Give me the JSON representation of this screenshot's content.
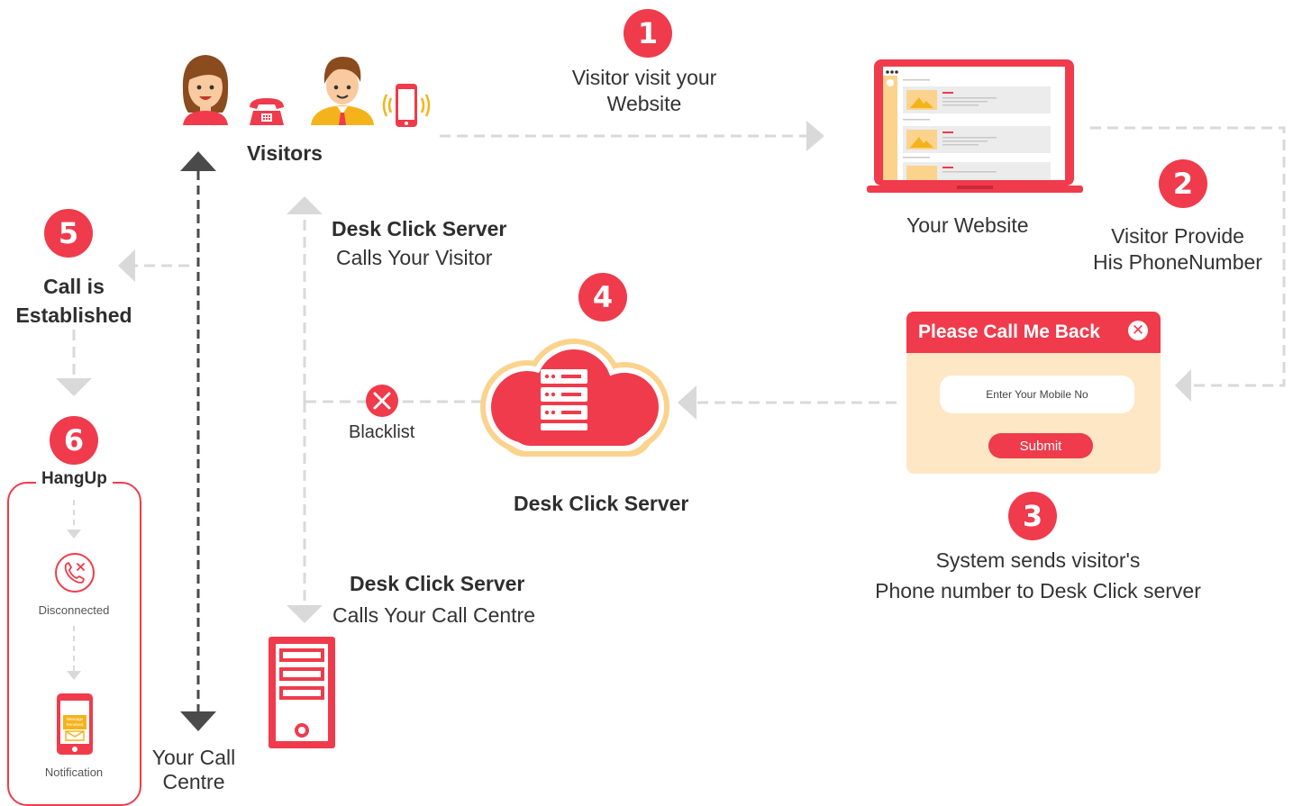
{
  "steps": {
    "s1": {
      "number": "1",
      "line1": "Visitor visit your",
      "line2": "Website"
    },
    "s2": {
      "number": "2",
      "line1": "Visitor Provide",
      "line2": "His PhoneNumber"
    },
    "s3": {
      "number": "3",
      "line1": "System sends visitor's",
      "line2": "Phone number to Desk Click server"
    },
    "s4": {
      "number": "4"
    },
    "s5": {
      "number": "5",
      "line1": "Call is",
      "line2": "Established"
    },
    "s6": {
      "number": "6"
    }
  },
  "labels": {
    "visitors": "Visitors",
    "your_website": "Your Website",
    "desk_click_server": "Desk Click Server",
    "calls_visitor_title": "Desk Click Server",
    "calls_visitor_sub": "Calls Your Visitor",
    "calls_centre_title": "Desk Click Server",
    "calls_centre_sub": "Calls Your Call Centre",
    "blacklist": "Blacklist",
    "call_centre_line1": "Your Call",
    "call_centre_line2": "Centre"
  },
  "popup": {
    "title": "Please Call Me Back",
    "close_glyph": "✕",
    "input_placeholder": "Enter Your Mobile No",
    "submit_label": "Submit"
  },
  "hangup": {
    "title": "HangUp",
    "disconnected": "Disconnected",
    "notification": "Notification",
    "message_line1": "Message",
    "message_line2": "Received"
  },
  "colors": {
    "accent": "#ef3b4b",
    "arrow": "#d9d9d9",
    "dark_arrow": "#4a4a4a",
    "popup_bg": "#fde7c4",
    "cloud_outline": "#fbd38d",
    "skin": "#f9c9a0"
  },
  "icons": {
    "visitor_woman": "woman-avatar-icon",
    "telephone": "telephone-icon",
    "visitor_man": "man-avatar-icon",
    "mobile": "ringing-mobile-icon",
    "laptop": "laptop-icon",
    "cloud_server": "cloud-server-icon",
    "blacklist": "x-circle-icon",
    "disconnected": "call-end-icon",
    "notification": "phone-message-icon",
    "server_tower": "server-tower-icon"
  }
}
